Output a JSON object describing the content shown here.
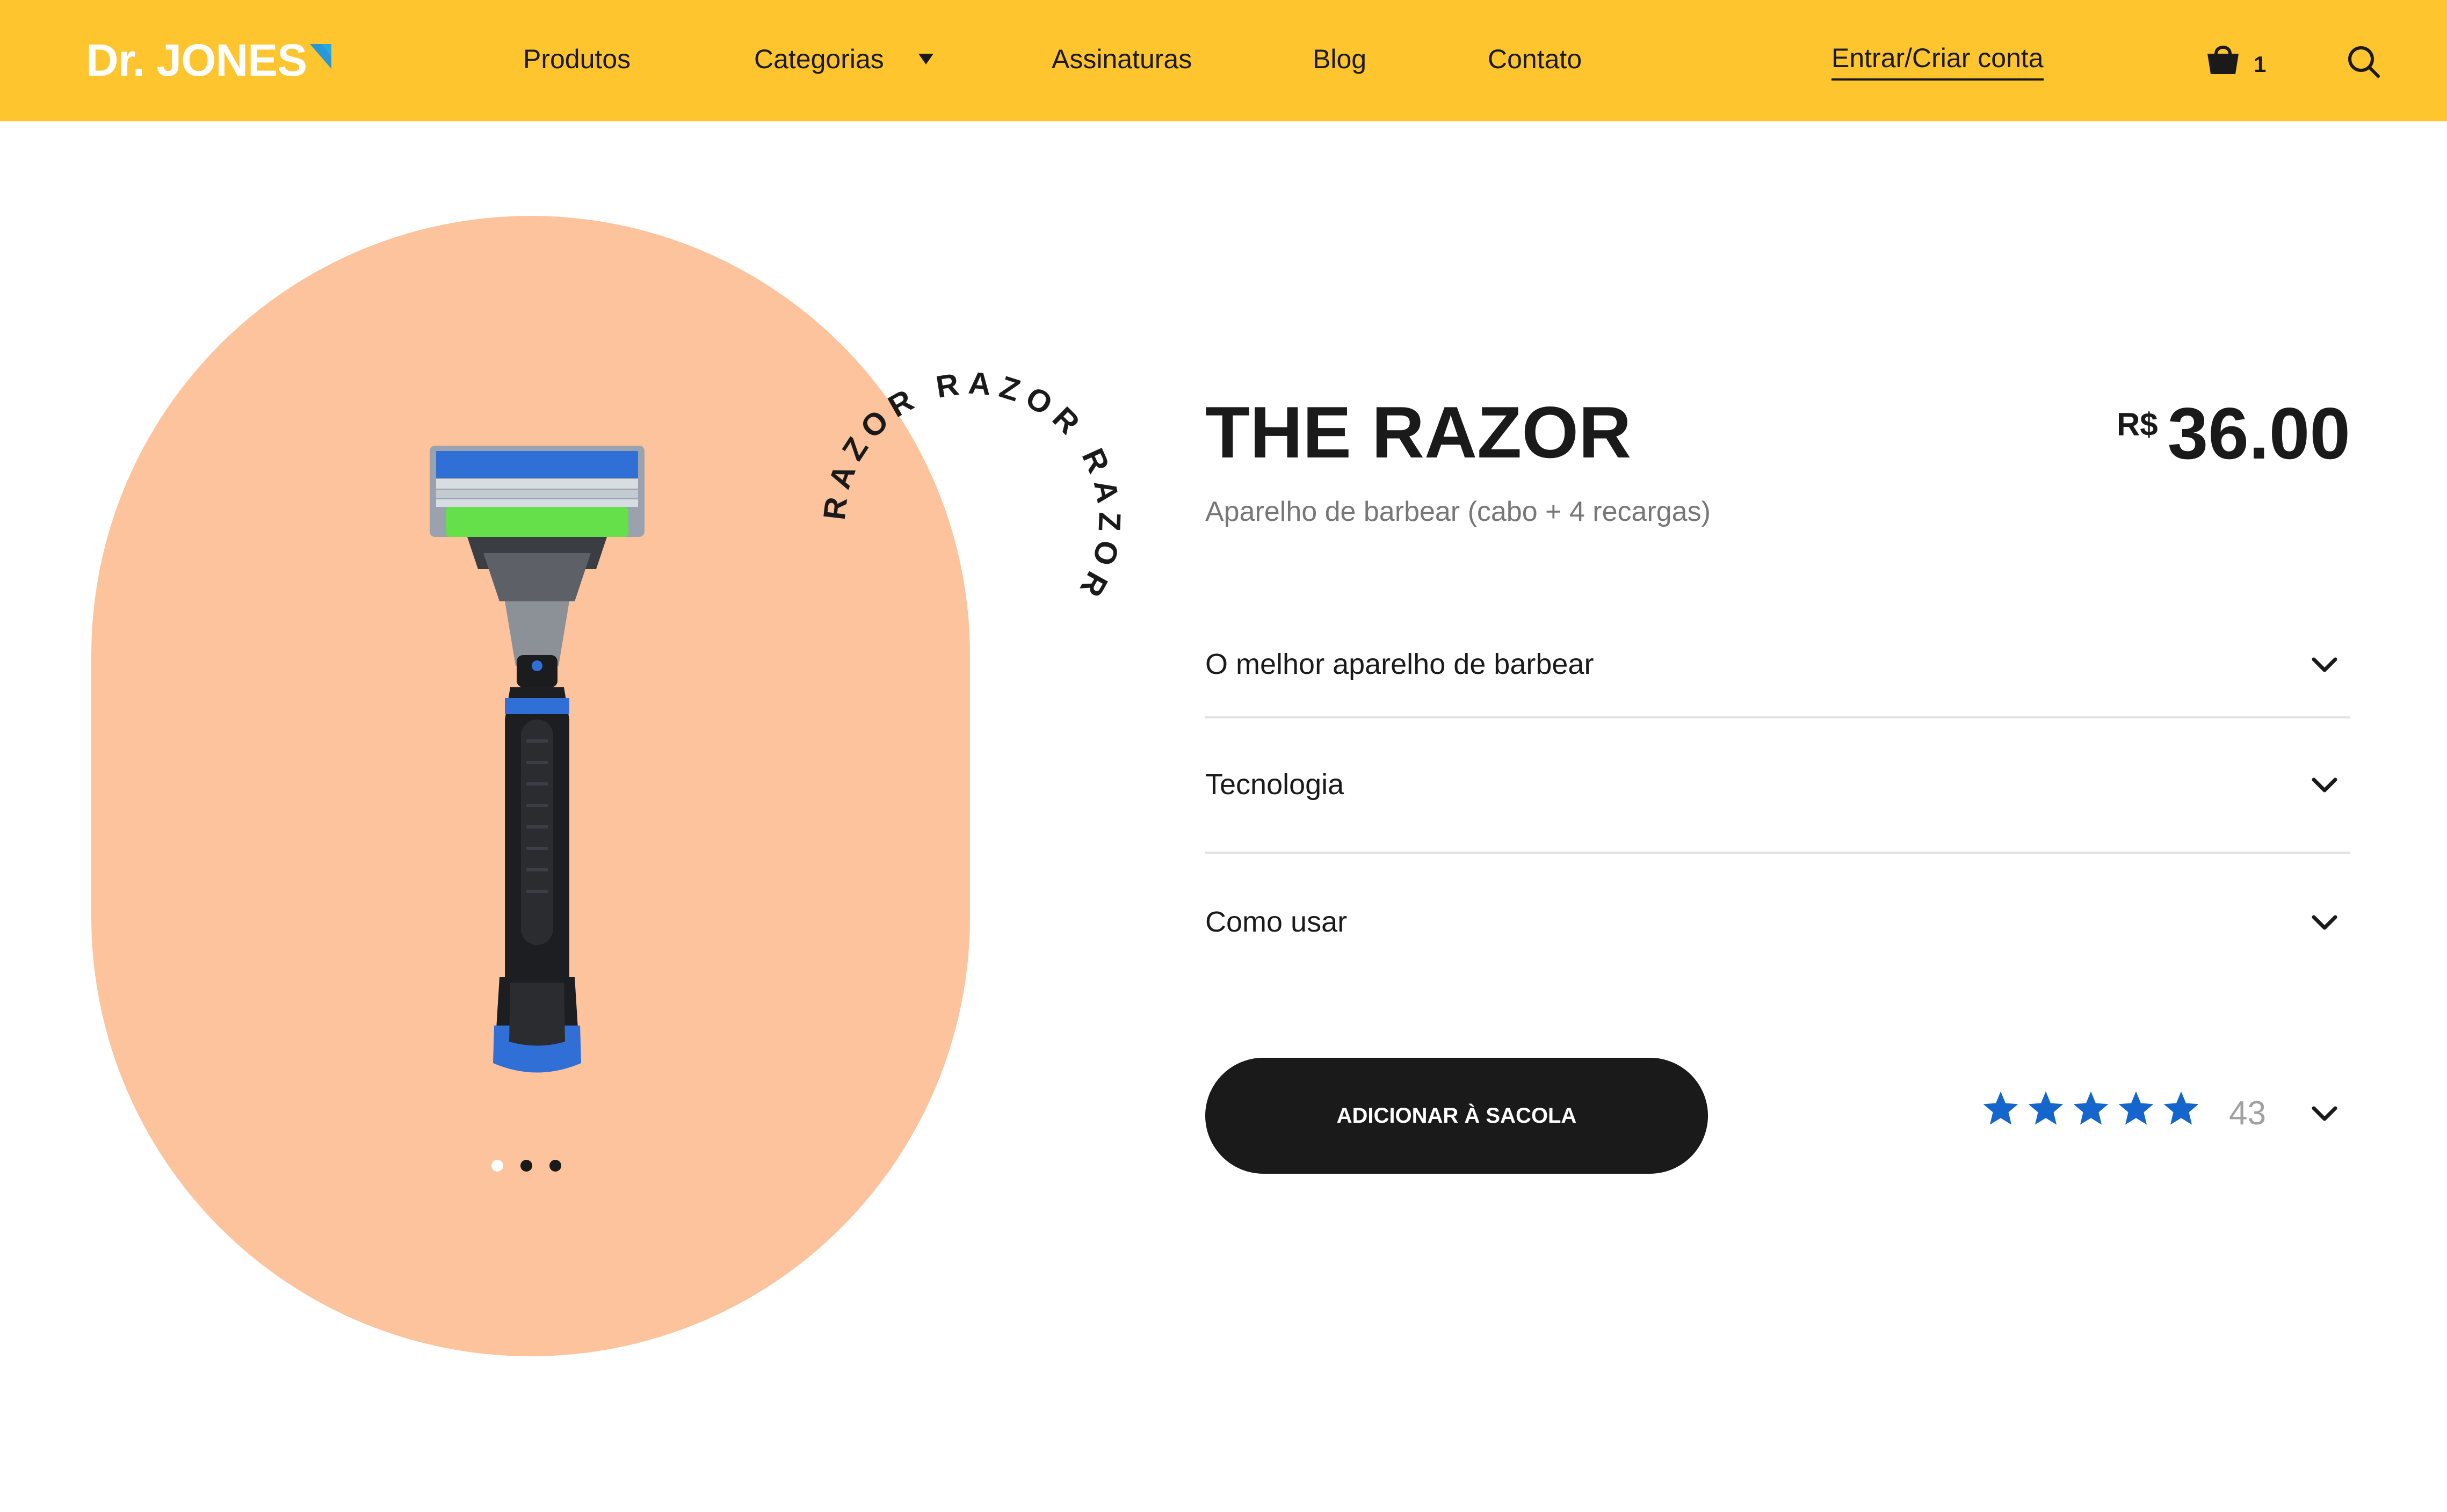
{
  "header": {
    "logo_text": "Dr. JONES",
    "nav": [
      "Produtos",
      "Categorias",
      "Assinaturas",
      "Blog",
      "Contato"
    ],
    "account_link": "Entrar/Criar conta",
    "cart_count": "1",
    "icons": [
      "cart-icon",
      "search-icon",
      "chevron-down-icon"
    ]
  },
  "gallery": {
    "ring_text": "RAZOR RAZOR RAZOR",
    "slide_count": 3,
    "active_slide": 1
  },
  "product": {
    "title": "THE RAZOR",
    "currency": "R$",
    "price": "36.00",
    "subtitle": "Aparelho de barbear (cabo + 4 recargas)",
    "accordions": [
      "O melhor aparelho de barbear",
      "Tecnologia",
      "Como usar"
    ],
    "add_to_bag": "ADICIONAR À SACOLA",
    "rating_stars": 5,
    "review_count": "43"
  },
  "colors": {
    "header_bg": "#ffc52f",
    "blob_bg": "#fdc39c",
    "button_bg": "#1a1a1a",
    "star": "#1466cc",
    "logo_accent": "#2aa8e0"
  }
}
